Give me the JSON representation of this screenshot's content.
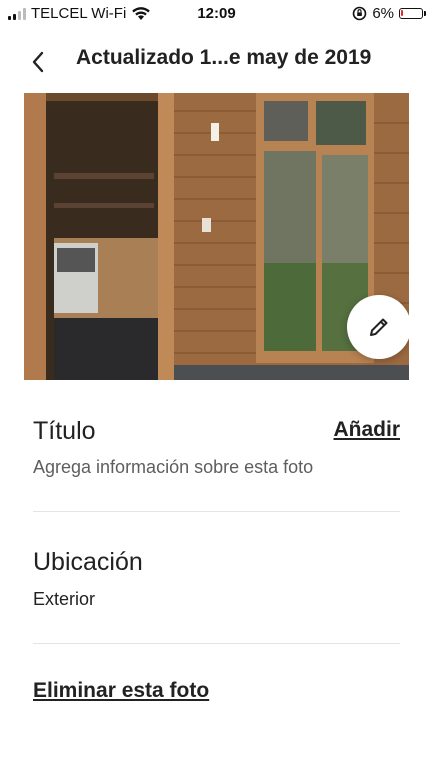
{
  "status_bar": {
    "carrier": "TELCEL Wi-Fi",
    "time": "12:09",
    "battery": "6%",
    "battery_level": 0.06,
    "icons": [
      "signal-icon",
      "wifi-icon",
      "orientation-lock-icon",
      "battery-icon"
    ]
  },
  "header": {
    "back_icon": "chevron-left-icon",
    "title": "Actualizado 1...e may de 2019"
  },
  "photo": {
    "description_icon": "photo",
    "edit_icon": "pencil-icon"
  },
  "title_section": {
    "label": "Título",
    "action": "Añadir",
    "subtitle": "Agrega información sobre esta foto"
  },
  "location_section": {
    "label": "Ubicación",
    "value": "Exterior"
  },
  "delete_action": "Eliminar esta foto",
  "colors": {
    "text": "#222222",
    "secondary_text": "#5e5e5e",
    "divider": "#e4e4e4",
    "battery_low": "#e0282d"
  }
}
